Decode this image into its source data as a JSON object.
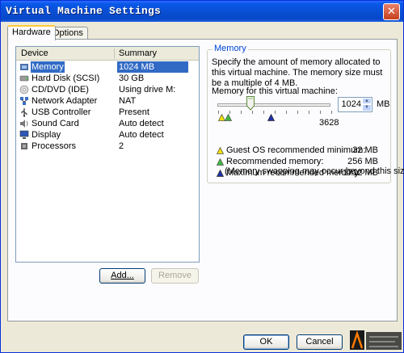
{
  "window": {
    "title": "Virtual Machine Settings",
    "close_glyph": "✕"
  },
  "tabs": [
    {
      "label": "Hardware",
      "active": true
    },
    {
      "label": "Options",
      "active": false
    }
  ],
  "device_list": {
    "columns": [
      "Device",
      "Summary"
    ],
    "rows": [
      {
        "name": "Memory",
        "summary": "1024 MB",
        "icon": "memory-icon",
        "selected": true
      },
      {
        "name": "Hard Disk (SCSI)",
        "summary": "30 GB",
        "icon": "hard-disk-icon"
      },
      {
        "name": "CD/DVD (IDE)",
        "summary": "Using drive M:",
        "icon": "cd-dvd-icon"
      },
      {
        "name": "Network Adapter",
        "summary": "NAT",
        "icon": "network-adapter-icon"
      },
      {
        "name": "USB Controller",
        "summary": "Present",
        "icon": "usb-icon"
      },
      {
        "name": "Sound Card",
        "summary": "Auto detect",
        "icon": "sound-card-icon"
      },
      {
        "name": "Display",
        "summary": "Auto detect",
        "icon": "display-icon"
      },
      {
        "name": "Processors",
        "summary": "2",
        "icon": "processor-icon"
      }
    ]
  },
  "buttons": {
    "add": "Add...",
    "remove": "Remove",
    "ok": "OK",
    "cancel": "Cancel"
  },
  "memory": {
    "group_title": "Memory",
    "description": "Specify the amount of memory allocated to this virtual machine. The memory size must be a multiple of 4 MB.",
    "field_label": "Memory for this virtual machine:",
    "value": "1024",
    "unit": "MB",
    "slider_max_label": "3628",
    "slider_level": 1024,
    "slider_range": [
      4,
      3628
    ],
    "legend": [
      {
        "label": "Guest OS recommended minimum:",
        "value": "32 MB",
        "marker": "yellow-triangle",
        "color": "#f0e000"
      },
      {
        "label": "Recommended memory:",
        "value": "256 MB",
        "marker": "green-triangle",
        "color": "#3dbb3d"
      },
      {
        "label": "Maximum recommended memory:",
        "value": "1712 MB",
        "marker": "blue-triangle",
        "color": "#1f2fa8"
      }
    ],
    "note": "(Memory swapping may occur beyond this size)"
  },
  "colors": {
    "selection": "#316ac5",
    "titlebar": "#0a4fd4",
    "group_title": "#0046d5"
  }
}
